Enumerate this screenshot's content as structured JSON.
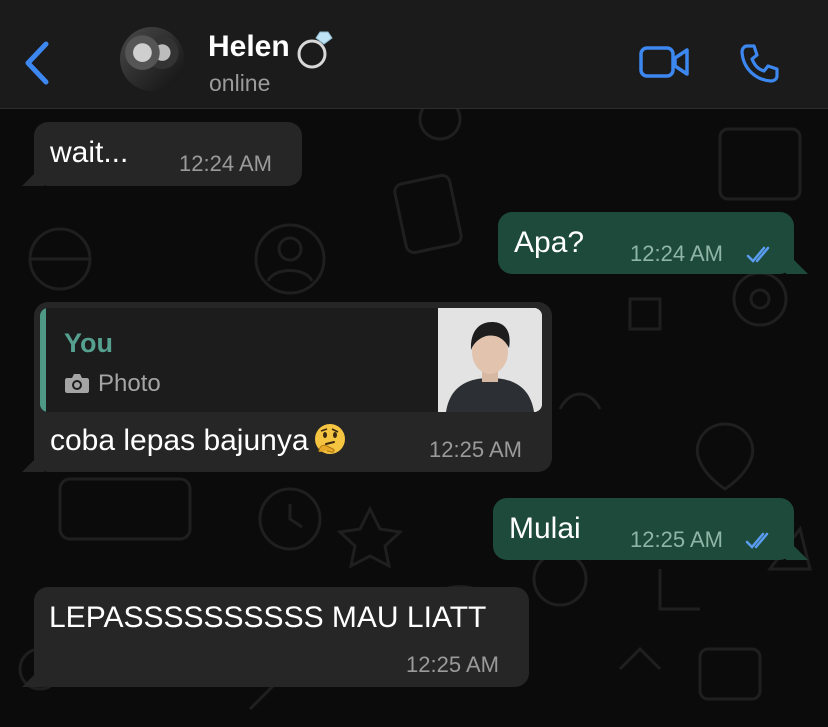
{
  "header": {
    "contact_name": "Helen",
    "status": "online",
    "icons": [
      "back-chevron-icon",
      "ring-icon",
      "video-call-icon",
      "phone-call-icon"
    ]
  },
  "messages": [
    {
      "direction": "incoming",
      "text": "wait...",
      "time": "12:24 AM"
    },
    {
      "direction": "outgoing",
      "text": "Apa?",
      "time": "12:24 AM",
      "read": true
    },
    {
      "direction": "incoming",
      "quote": {
        "author": "You",
        "type": "Photo"
      },
      "text": "coba lepas bajunya",
      "emoji": "thinking-face",
      "time": "12:25 AM"
    },
    {
      "direction": "outgoing",
      "text": "Mulai",
      "time": "12:25 AM",
      "read": true
    },
    {
      "direction": "incoming",
      "text": "LEPASSSSSSSSSS MAU LIATT",
      "time": "12:25 AM"
    }
  ],
  "colors": {
    "accent": "#3c87f0",
    "outgoing_bubble": "#1e4a3b",
    "incoming_bubble": "#262626",
    "read_ticks": "#5a9cf0",
    "quote_author": "#55a08e"
  }
}
